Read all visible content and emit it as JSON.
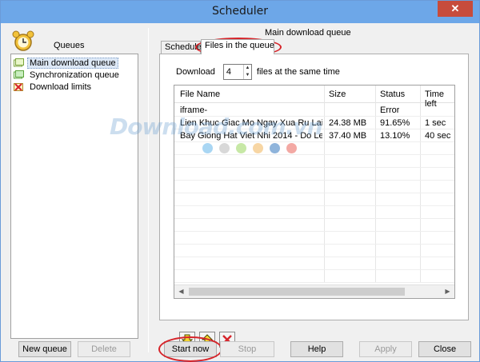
{
  "window": {
    "title": "Scheduler",
    "close_glyph": "✕"
  },
  "left_panel": {
    "header": "Queues",
    "items": [
      {
        "label": "Main download queue",
        "icon": "queue-icon",
        "selected": true
      },
      {
        "label": "Synchronization queue",
        "icon": "sync-queue-icon",
        "selected": false
      },
      {
        "label": "Download limits",
        "icon": "limits-icon",
        "selected": false
      }
    ],
    "new_queue_label": "New queue",
    "delete_label": "Delete"
  },
  "right_panel": {
    "title": "Main download queue",
    "tabs": [
      {
        "label": "Schedule",
        "active": false
      },
      {
        "label": "Files in the queue",
        "active": true
      }
    ],
    "download_prefix": "Download",
    "concurrent_value": "4",
    "download_suffix": "files at the same time",
    "columns": [
      "File Name",
      "Size",
      "Status",
      "Time left"
    ],
    "rows": [
      {
        "file": "iframe-",
        "size": "",
        "status": "Error",
        "time": ""
      },
      {
        "file": "Lien Khuc Giac Mo Ngay Xua Ru Lai ...",
        "size": "24.38  MB",
        "status": "91.65%",
        "time": "1 sec"
      },
      {
        "file": "Bay Giong Hat Viet Nhi 2014 - Do Le ...",
        "size": "37.40  MB",
        "status": "13.10%",
        "time": "40 sec"
      }
    ],
    "queue_buttons": [
      "move-down-icon",
      "move-up-icon",
      "remove-icon"
    ]
  },
  "watermark": "Download.com.vn",
  "bottom_bar": {
    "start_now": "Start now",
    "stop": "Stop",
    "help": "Help",
    "apply": "Apply",
    "close": "Close"
  },
  "colors": {
    "titlebar": "#6da7e8",
    "close": "#c74c3c",
    "annotation": "#d6242a",
    "selection": "#dde8f6"
  }
}
